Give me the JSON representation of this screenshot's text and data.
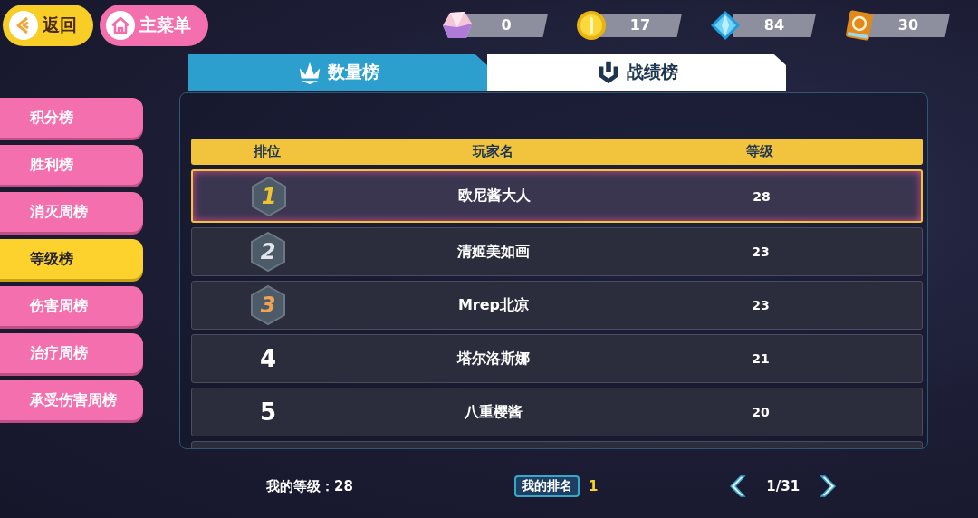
{
  "top_bar": {
    "back_button": "返回",
    "main_menu_button": "主菜单"
  },
  "currencies": [
    {
      "kind": "crystal",
      "amount": "0"
    },
    {
      "kind": "coin",
      "amount": "17"
    },
    {
      "kind": "diamond",
      "amount": "84"
    },
    {
      "kind": "card",
      "amount": "30"
    }
  ],
  "tabs": [
    {
      "label": "数量榜",
      "kind": "crown",
      "selected": true
    },
    {
      "label": "战绩榜",
      "kind": "shield",
      "selected": false
    }
  ],
  "sidebar": {
    "items": [
      {
        "label": "积分榜",
        "selected": false
      },
      {
        "label": "胜利榜",
        "selected": false
      },
      {
        "label": "消灭周榜",
        "selected": false
      },
      {
        "label": "等级榜",
        "selected": true
      },
      {
        "label": "伤害周榜",
        "selected": false
      },
      {
        "label": "治疗周榜",
        "selected": false
      },
      {
        "label": "承受伤害周榜",
        "selected": false
      }
    ]
  },
  "table": {
    "columns": [
      "排位",
      "玩家名",
      "等级"
    ],
    "rows": [
      {
        "rank": "1",
        "kind": "medal",
        "color": "#f2c230",
        "player": "欧尼酱大人",
        "level": "28",
        "selected": true
      },
      {
        "rank": "2",
        "kind": "medal",
        "color": "#e4e6ee",
        "player": "清姬美如画",
        "level": "23",
        "selected": false
      },
      {
        "rank": "3",
        "kind": "medal",
        "color": "#f0a453",
        "player": "Mrep北凉",
        "level": "23",
        "selected": false
      },
      {
        "rank": "4",
        "kind": "plain",
        "player": "塔尔洛斯娜",
        "level": "21",
        "selected": false
      },
      {
        "rank": "5",
        "kind": "plain",
        "player": "八重樱酱",
        "level": "20",
        "selected": false
      }
    ]
  },
  "footer": {
    "my_level": "我的等级：28",
    "my_rank_label": "我的排名",
    "my_rank": "1",
    "page": "1/31"
  }
}
